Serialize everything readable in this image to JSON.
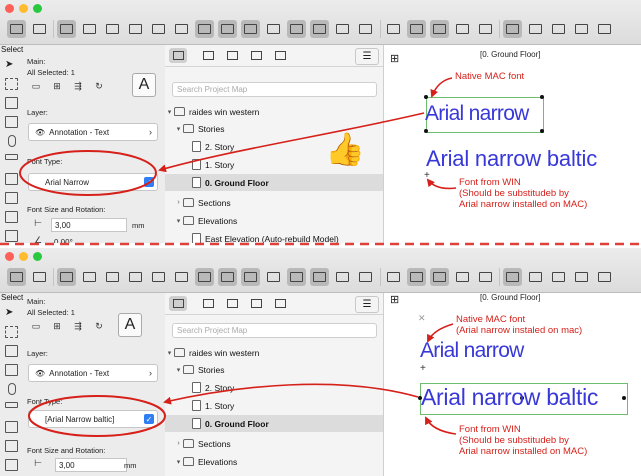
{
  "panes": [
    {
      "infobox": {
        "select_label": "Select",
        "main_label": "Main:",
        "all_selected": "All Selected: 1",
        "text_tool_glyph": "A",
        "layer_label": "Layer:",
        "layer_value": "Annotation - Text",
        "font_type_label": "Font Type:",
        "font_value": "Arial Narrow",
        "size_rotation_label": "Font Size and Rotation:",
        "size_value": "3,00",
        "size_unit": "mm",
        "rotation_value": "0,00°"
      },
      "navigator": {
        "search_placeholder": "Search Project Map",
        "tree": [
          "raides win western",
          "Stories",
          "2. Story",
          "1. Story",
          "0. Ground Floor",
          "Sections",
          "Elevations",
          "East Elevation (Auto-rebuild Model)"
        ]
      },
      "canvas": {
        "floor_tag": "[0. Ground Floor]",
        "text_lines": [
          "Arial narrow",
          "Arial narrow baltic"
        ]
      },
      "notes": {
        "native": "Native MAC font",
        "from_win": [
          "Font from WIN",
          "(Should be substitudeb by",
          "Arial narrow installed on MAC)"
        ]
      },
      "thumbs_up": "👍"
    },
    {
      "infobox": {
        "select_label": "Select",
        "main_label": "Main:",
        "all_selected": "All Selected: 1",
        "text_tool_glyph": "A",
        "layer_label": "Layer:",
        "layer_value": "Annotation - Text",
        "font_type_label": "Font Type:",
        "font_value": "[Arial Narrow baltic]",
        "size_rotation_label": "Font Size and Rotation:",
        "size_value": "3,00",
        "size_unit": "mm"
      },
      "navigator": {
        "search_placeholder": "Search Project Map",
        "tree": [
          "raides win western",
          "Stories",
          "2. Story",
          "1. Story",
          "0. Ground Floor",
          "Sections",
          "Elevations"
        ]
      },
      "canvas": {
        "floor_tag": "[0. Ground Floor]",
        "text_lines": [
          "Arial narrow",
          "Arial narrow baltic"
        ]
      },
      "notes": {
        "native": [
          "Native MAC font",
          "(Arial narrow instaled on mac)"
        ],
        "from_win": [
          "Font from WIN",
          "(Should be substitudeb by",
          "Arial narrow installed on MAC)"
        ]
      }
    }
  ],
  "colors": {
    "annotation_red": "#d6201a",
    "text_blue": "#3838d8",
    "dash_red": "#e0403a"
  },
  "toolbar_icons": [
    "pointer-icon",
    "layout-icon",
    "wall-icon",
    "beam-icon",
    "column-icon",
    "slab-icon",
    "stair-icon",
    "railing-icon",
    "hatch-icon",
    "zone-icon",
    "object-icon",
    "text-icon",
    "dimension-icon",
    "window-icon",
    "door-icon",
    "settings-icon"
  ]
}
